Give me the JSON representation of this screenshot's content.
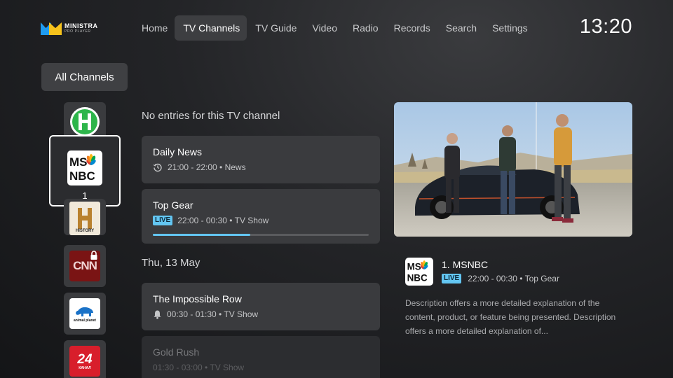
{
  "brand": {
    "name": "MINISTRA",
    "sub": "PRO PLAYER"
  },
  "nav": {
    "items": [
      {
        "label": "Home"
      },
      {
        "label": "TV Channels",
        "active": true
      },
      {
        "label": "TV Guide"
      },
      {
        "label": "Video"
      },
      {
        "label": "Radio"
      },
      {
        "label": "Records"
      },
      {
        "label": "Search"
      },
      {
        "label": "Settings"
      }
    ]
  },
  "clock": "13:20",
  "filter": {
    "label": "All Channels"
  },
  "channels": [
    {
      "name": "H channel",
      "icon": "h-channel-logo"
    },
    {
      "name": "MSNBC",
      "number": "1",
      "selected": true,
      "icon": "msnbc-logo"
    },
    {
      "name": "History",
      "logo_text": "HISTORY",
      "icon": "history-logo"
    },
    {
      "name": "CNN",
      "logo_text": "CNN",
      "locked": true,
      "icon": "cnn-logo"
    },
    {
      "name": "Animal Planet",
      "logo_text": "animal planet",
      "icon": "animal-planet-logo"
    },
    {
      "name": "24 Kanal",
      "logo_text": "24",
      "sub_text": "КАНАЛ",
      "icon": "24-kanal-logo"
    }
  ],
  "program_list": {
    "empty_message": "No entries for this TV channel",
    "items": [
      {
        "title": "Daily News",
        "meta": "21:00 - 22:00 • News",
        "icon": "replay-icon"
      },
      {
        "title": "Top Gear",
        "badge": "LIVE",
        "meta": "22:00 - 00:30 • TV Show",
        "progress": 0.45
      }
    ],
    "date_header": "Thu, 13 May",
    "items_next": [
      {
        "title": "The Impossible Row",
        "meta": "00:30 - 01:30 • TV Show",
        "icon": "bell-icon"
      },
      {
        "title": "Gold Rush",
        "meta": "01:30 - 03:00 • TV Show"
      }
    ]
  },
  "info": {
    "title": "1. MSNBC",
    "badge": "LIVE",
    "meta": "22:00 - 00:30 • Top Gear",
    "description": "Description offers a more detailed explanation of the content, product, or feature being presented. Description offers a more detailed explanation of..."
  },
  "colors": {
    "accent": "#63c6f2",
    "card": "#3a3b3e",
    "active_nav": "#3d3e41"
  }
}
